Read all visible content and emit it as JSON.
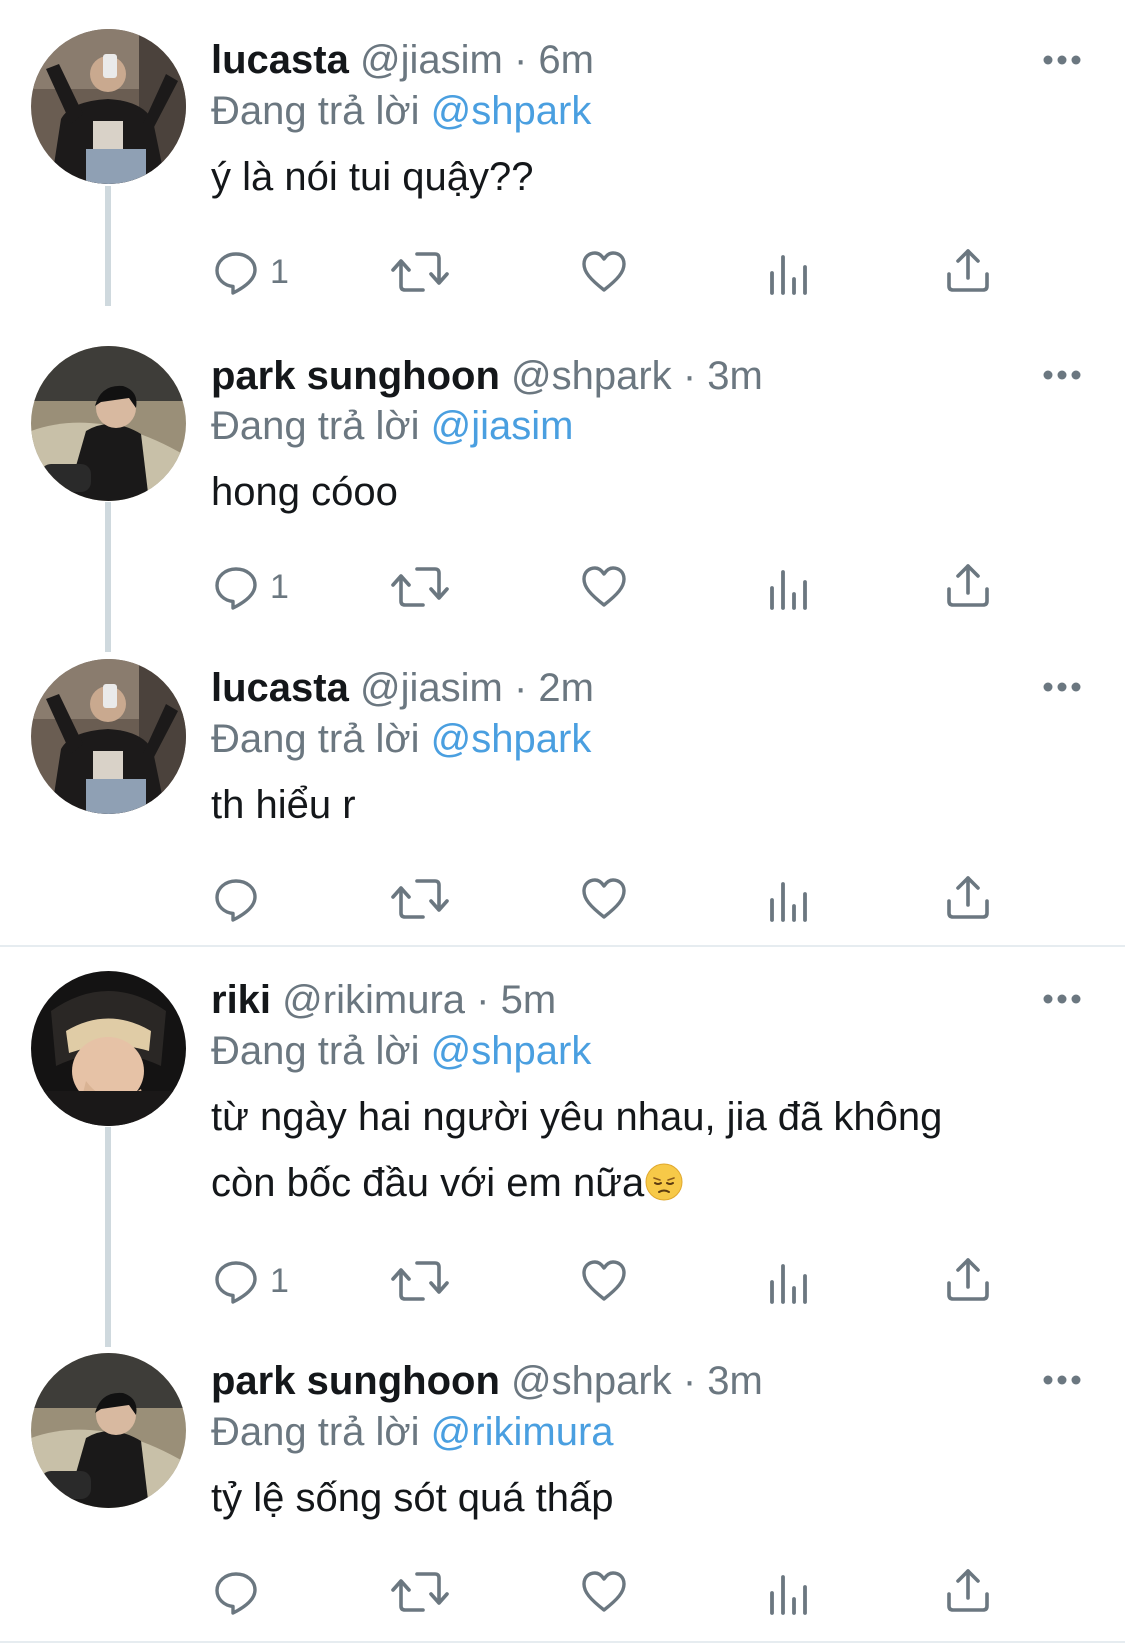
{
  "tweets": [
    {
      "name": "lucasta",
      "handle": "@jiasim",
      "time": "6m",
      "reply_label": "Đang trả lời",
      "reply_to": "@shpark",
      "text": "ý là nói tui quậy??",
      "reply_count": "1"
    },
    {
      "name": "park sunghoon",
      "handle": "@shpark",
      "time": "3m",
      "reply_label": "Đang trả lời",
      "reply_to": "@jiasim",
      "text": "hong cóoo",
      "reply_count": "1"
    },
    {
      "name": "lucasta",
      "handle": "@jiasim",
      "time": "2m",
      "reply_label": "Đang trả lời",
      "reply_to": "@shpark",
      "text": "th hiểu r",
      "reply_count": ""
    },
    {
      "name": "riki",
      "handle": "@rikimura",
      "time": "5m",
      "reply_label": "Đang trả lời",
      "reply_to": "@shpark",
      "text_line1": "từ ngày hai người yêu nhau, jia đã không",
      "text_line2": "còn bốc đầu với em nữa",
      "emoji": "pensive-face",
      "reply_count": "1"
    },
    {
      "name": "park sunghoon",
      "handle": "@shpark",
      "time": "3m",
      "reply_label": "Đang trả lời",
      "reply_to": "@rikimura",
      "text": "tỷ lệ sống sót quá thấp",
      "reply_count": ""
    }
  ],
  "separator": "·",
  "colors": {
    "mention": "#4a9fe0",
    "secondary_text": "#6b7780",
    "primary_text": "#14171a",
    "thread_line": "#cfd9de"
  }
}
